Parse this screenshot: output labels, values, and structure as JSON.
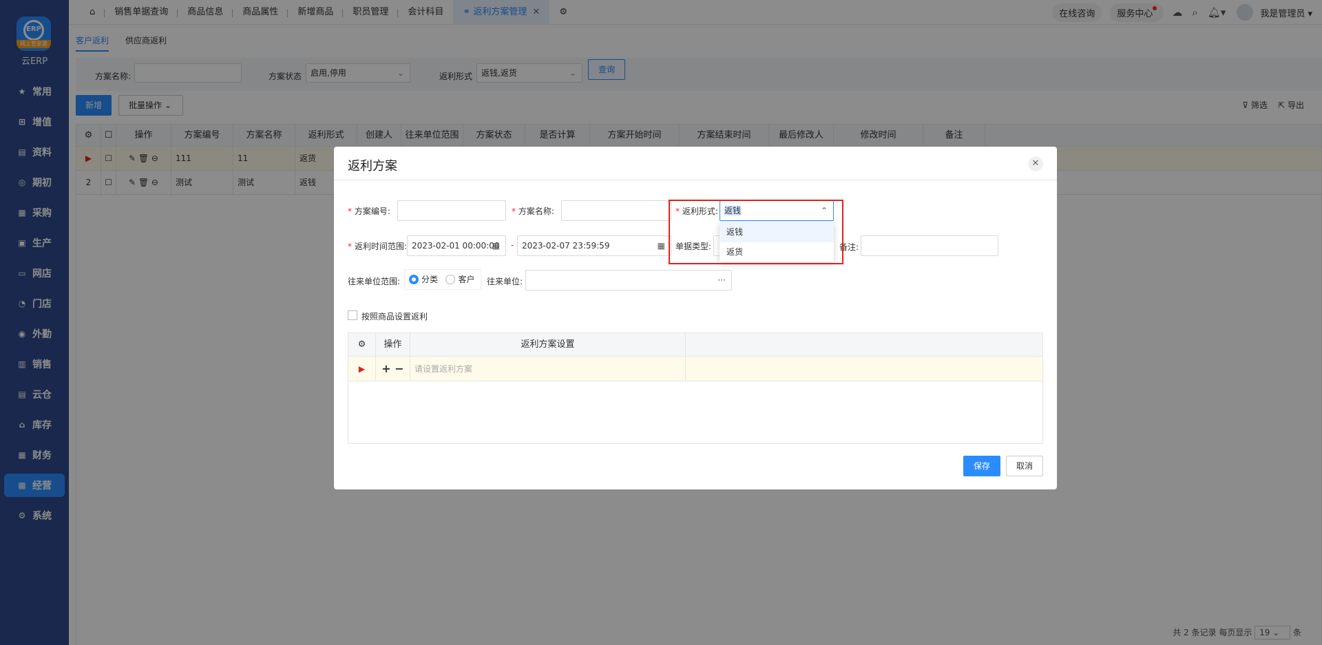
{
  "brand": {
    "logo_text": "ERP",
    "ribbon": "网上管家婆",
    "name": "云ERP"
  },
  "sidebar": {
    "items": [
      {
        "label": "常用",
        "icon": "star-icon"
      },
      {
        "label": "增值",
        "icon": "plus-square-icon"
      },
      {
        "label": "资料",
        "icon": "document-icon"
      },
      {
        "label": "期初",
        "icon": "target-icon"
      },
      {
        "label": "采购",
        "icon": "purchase-icon"
      },
      {
        "label": "生产",
        "icon": "production-icon"
      },
      {
        "label": "网店",
        "icon": "store-icon"
      },
      {
        "label": "门店",
        "icon": "pie-icon"
      },
      {
        "label": "外勤",
        "icon": "compass-icon"
      },
      {
        "label": "销售",
        "icon": "chart-icon"
      },
      {
        "label": "云仓",
        "icon": "warehouse-icon"
      },
      {
        "label": "库存",
        "icon": "home-icon"
      },
      {
        "label": "财务",
        "icon": "finance-icon"
      },
      {
        "label": "经营",
        "icon": "business-icon"
      },
      {
        "label": "系统",
        "icon": "settings-icon"
      }
    ]
  },
  "topbar": {
    "tabs": [
      "销售单据查询",
      "商品信息",
      "商品属性",
      "新增商品",
      "职员管理",
      "会计科目"
    ],
    "active_tab": "返利方案管理",
    "consult": "在线咨询",
    "service": "服务中心",
    "user": "我是管理员"
  },
  "page": {
    "subtabs": [
      "客户返利",
      "供应商返利"
    ],
    "filter": {
      "name_label": "方案名称:",
      "status_label": "方案状态",
      "status_value": "启用,停用",
      "form_label": "返利形式",
      "form_value": "返钱,返货",
      "query": "查询"
    },
    "new_btn": "新增",
    "batch_btn": "批量操作",
    "filter_link": "筛选",
    "export_link": "导出",
    "columns": [
      "操作",
      "方案编号",
      "方案名称",
      "返利形式",
      "创建人",
      "往来单位范围",
      "方案状态",
      "是否计算",
      "方案开始时间",
      "方案结束时间",
      "最后修改人",
      "修改时间",
      "备注"
    ],
    "rows": [
      {
        "idx": "",
        "code": "111",
        "name": "11",
        "form": "返货"
      },
      {
        "idx": "2",
        "code": "测试",
        "name": "测试",
        "form": "返钱"
      }
    ],
    "pager": {
      "total": "共 2 条记录",
      "per_page_label": "每页显示",
      "per_page": "19",
      "unit": "条"
    }
  },
  "modal": {
    "title": "返利方案",
    "code_label": "方案编号:",
    "name_label": "方案名称:",
    "form_label": "返利形式:",
    "form_value": "返钱",
    "time_label": "返利时间范围:",
    "start": "2023-02-01 00:00:00",
    "dash": "-",
    "end": "2023-02-07 23:59:59",
    "bill_label": "单据类型:",
    "remark_label": "备注:",
    "scope_label": "往来单位范围:",
    "scope_opt1": "分类",
    "scope_opt2": "客户",
    "unit_label": "往来单位:",
    "unit_more": "···",
    "by_product": "按照商品设置返利",
    "grid_op": "操作",
    "grid_setting": "返利方案设置",
    "placeholder": "请设置返利方案",
    "options": [
      "返钱",
      "返货"
    ],
    "save": "保存",
    "cancel": "取消"
  }
}
